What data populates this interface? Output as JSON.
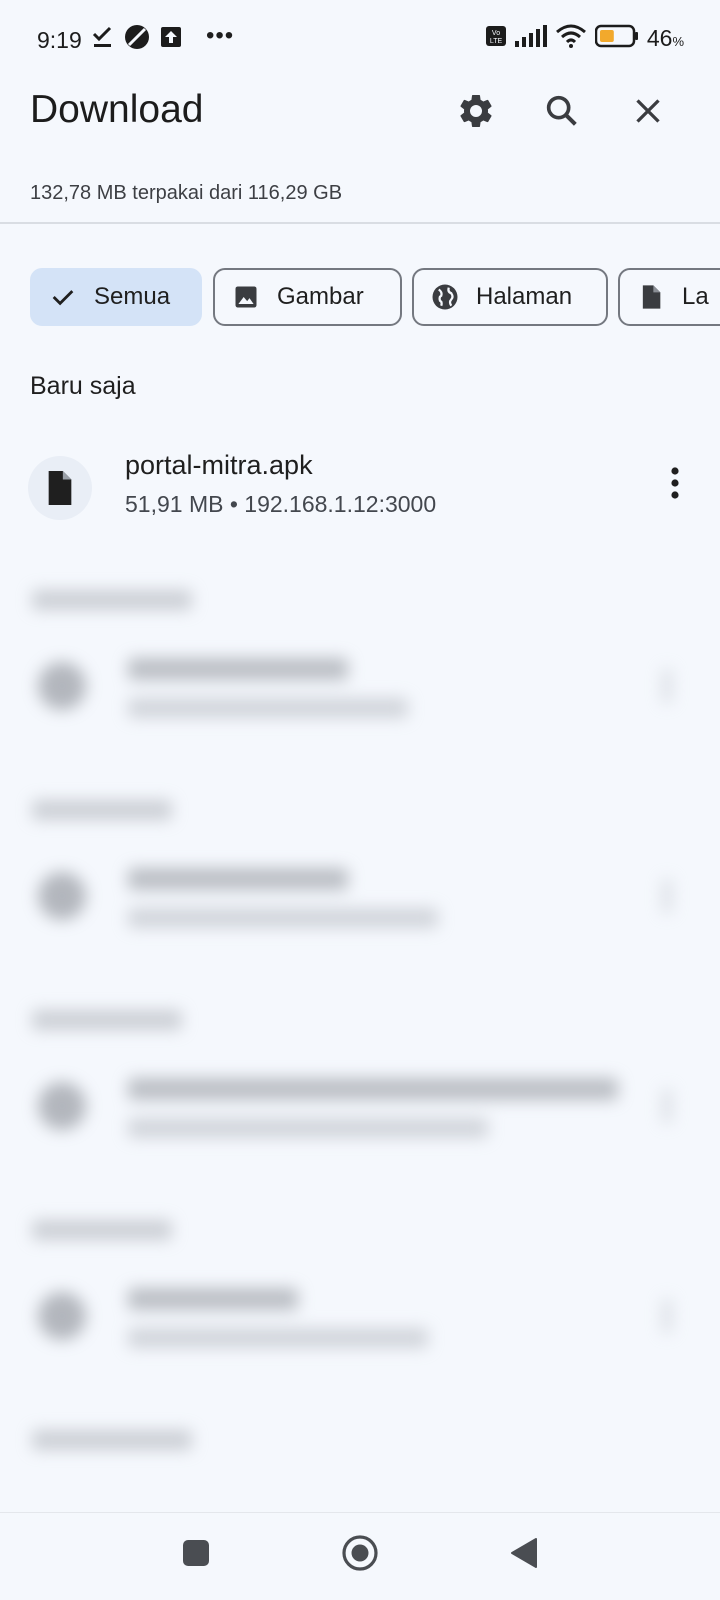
{
  "status_bar": {
    "time": "9:19",
    "battery_percent": "46",
    "battery_unit": "%",
    "battery_level": 0.46,
    "icons": [
      "check-download-icon",
      "no-disturb-icon",
      "upload-icon",
      "more-dots-icon",
      "volte-icon",
      "signal-icon",
      "wifi-icon",
      "battery-icon"
    ]
  },
  "header": {
    "title": "Download",
    "icons": [
      "settings-icon",
      "search-icon",
      "close-icon"
    ]
  },
  "storage": {
    "usage_text": "132,78 MB terpakai dari 116,29 GB"
  },
  "filters": [
    {
      "label": "Semua",
      "icon": "check-icon",
      "selected": true
    },
    {
      "label": "Gambar",
      "icon": "image-icon",
      "selected": false
    },
    {
      "label": "Halaman",
      "icon": "globe-icon",
      "selected": false
    },
    {
      "label": "La",
      "icon": "document-icon",
      "selected": false
    }
  ],
  "recent": {
    "section_label": "Baru saja",
    "items": [
      {
        "title": "portal-mitra.apk",
        "subtitle": "51,91 MB • 192.168.1.12:3000",
        "icon": "file-icon"
      }
    ]
  },
  "nav": {
    "icons": [
      "recents-square-icon",
      "home-circle-icon",
      "back-triangle-icon"
    ]
  }
}
